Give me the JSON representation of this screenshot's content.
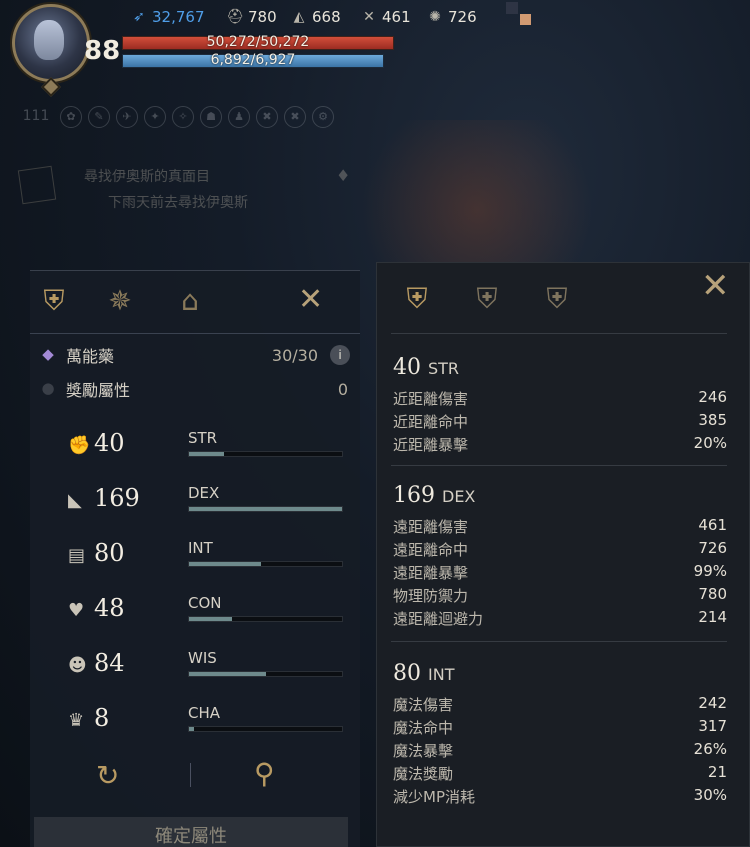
{
  "hud": {
    "level": "88",
    "top_stats": [
      {
        "icon": "wing-icon",
        "glyph": "➶",
        "value": "32,767"
      },
      {
        "icon": "helmet-icon",
        "glyph": "⛑",
        "value": "780"
      },
      {
        "icon": "wizard-hat-icon",
        "glyph": "◭",
        "value": "668"
      },
      {
        "icon": "crossed-bow-icon",
        "glyph": "✕",
        "value": "461"
      },
      {
        "icon": "spark-icon",
        "glyph": "✺",
        "value": "726"
      }
    ],
    "hp": "50,272/50,272",
    "mp": "6,892/6,927",
    "hp_fraction": 1.0,
    "mp_fraction": 0.9949,
    "colors": {
      "hp": "#d24e3a",
      "mp": "#6da9da",
      "wing": "#4f9ee8"
    }
  },
  "buff_row": {
    "count_label": "111"
  },
  "quest": {
    "title": "尋找伊奧斯的真面目",
    "desc": "下雨天前去尋找伊奧斯"
  },
  "left_panel": {
    "tabs": [
      {
        "icon": "knight-helmet-icon",
        "glyph": "⛨"
      },
      {
        "icon": "compass-star-icon",
        "glyph": "✵"
      },
      {
        "icon": "house-icon",
        "glyph": "⌂"
      }
    ],
    "close_glyph": "✕",
    "elixir_label": "萬能藥",
    "elixir_value": "30/30",
    "info_glyph": "i",
    "bonus_label": "獎勵屬性",
    "bonus_value": "0",
    "stats": [
      {
        "name": "STR",
        "value": "40",
        "icon": "muscle-arm-icon",
        "glyph": "✊",
        "fill": 0.23
      },
      {
        "name": "DEX",
        "value": "169",
        "icon": "boot-icon",
        "glyph": "◣",
        "fill": 1.0
      },
      {
        "name": "INT",
        "value": "80",
        "icon": "open-book-icon",
        "glyph": "▤",
        "fill": 0.47
      },
      {
        "name": "CON",
        "value": "48",
        "icon": "heart-pulse-icon",
        "glyph": "♥",
        "fill": 0.28
      },
      {
        "name": "WIS",
        "value": "84",
        "icon": "head-mind-icon",
        "glyph": "☻",
        "fill": 0.5
      },
      {
        "name": "CHA",
        "value": "8",
        "icon": "crown-icon",
        "glyph": "♛",
        "fill": 0.03
      }
    ],
    "reset_glyph": "↻",
    "search_glyph": "⚲",
    "confirm_label": "確定屬性"
  },
  "right_panel": {
    "tabs": [
      {
        "icon": "helmet-gear-icon",
        "glyph": "⛨"
      },
      {
        "icon": "helmet-plus-icon",
        "glyph": "⛨"
      },
      {
        "icon": "helmet-shield-icon",
        "glyph": "⛨"
      }
    ],
    "close_glyph": "✕",
    "sections": [
      {
        "value": "40",
        "name": "STR",
        "rows": [
          {
            "label": "近距離傷害",
            "value": "246"
          },
          {
            "label": "近距離命中",
            "value": "385"
          },
          {
            "label": "近距離暴擊",
            "value": "20%"
          }
        ]
      },
      {
        "value": "169",
        "name": "DEX",
        "rows": [
          {
            "label": "遠距離傷害",
            "value": "461"
          },
          {
            "label": "遠距離命中",
            "value": "726"
          },
          {
            "label": "遠距離暴擊",
            "value": "99%"
          },
          {
            "label": "物理防禦力",
            "value": "780"
          },
          {
            "label": "遠距離迴避力",
            "value": "214"
          }
        ]
      },
      {
        "value": "80",
        "name": "INT",
        "rows": [
          {
            "label": "魔法傷害",
            "value": "242"
          },
          {
            "label": "魔法命中",
            "value": "317"
          },
          {
            "label": "魔法暴擊",
            "value": "26%"
          },
          {
            "label": "魔法獎勵",
            "value": "21"
          },
          {
            "label": "減少MP消耗",
            "value": "30%"
          }
        ]
      }
    ]
  }
}
